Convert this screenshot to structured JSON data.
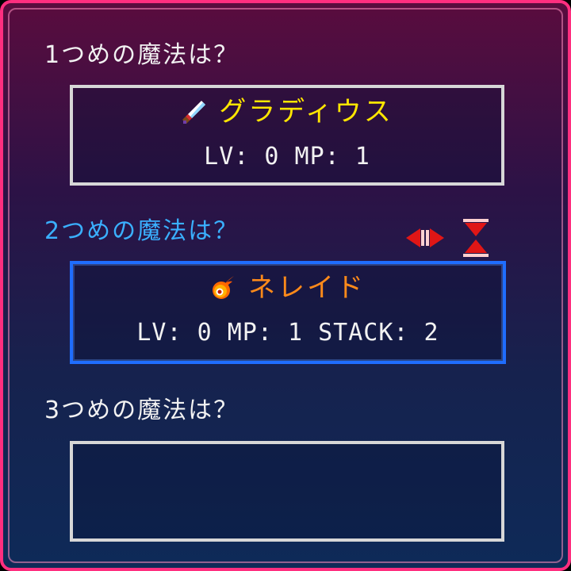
{
  "colors": {
    "frame": "#ff2e7f",
    "text": "#f2f2f2",
    "active_question": "#3ab0ff",
    "spell1_name": "#ffe600",
    "spell2_name": "#ff8a1a",
    "selected_border": "#1f6dff",
    "control_red": "#e01616"
  },
  "slots": [
    {
      "question": "1つめの魔法は？",
      "spell_icon": "sword-icon",
      "spell_name": "グラディウス",
      "stats": "LV: 0 MP: 1"
    },
    {
      "question": "2つめの魔法は？",
      "spell_icon": "fireball-icon",
      "spell_name": "ネレイド",
      "stats": "LV: 0 MP: 1 STACK: 2"
    },
    {
      "question": "3つめの魔法は？",
      "spell_icon": "",
      "spell_name": "",
      "stats": ""
    }
  ],
  "controls": {
    "left_right_icon": "left-right-arrows-icon",
    "up_down_icon": "up-down-arrows-icon"
  }
}
